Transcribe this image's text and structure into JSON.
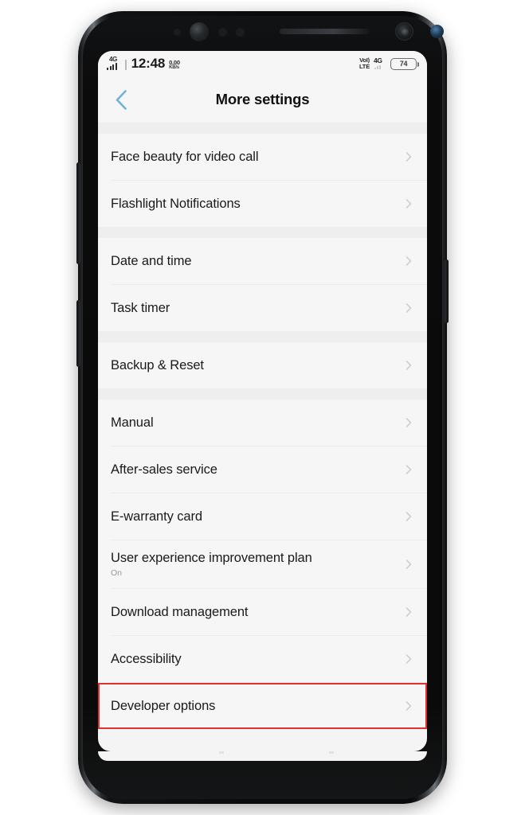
{
  "status_bar": {
    "network_type": "4G",
    "time": "12:48",
    "speed_value": "0.00",
    "speed_unit": "KB/s",
    "volte_line1": "VoI)",
    "volte_line2": "LTE",
    "data_network": "4G",
    "battery_percent": "74"
  },
  "header": {
    "back_label": "Back",
    "title": "More settings"
  },
  "groups": [
    {
      "rows": [
        {
          "title": "Face beauty for video call",
          "sub": ""
        },
        {
          "title": "Flashlight Notifications",
          "sub": ""
        }
      ]
    },
    {
      "rows": [
        {
          "title": "Date and time",
          "sub": ""
        },
        {
          "title": "Task timer",
          "sub": ""
        }
      ]
    },
    {
      "rows": [
        {
          "title": "Backup & Reset",
          "sub": ""
        }
      ]
    },
    {
      "rows": [
        {
          "title": "Manual",
          "sub": ""
        },
        {
          "title": "After-sales service",
          "sub": ""
        },
        {
          "title": "E-warranty card",
          "sub": ""
        },
        {
          "title": "User experience improvement plan",
          "sub": "On"
        },
        {
          "title": "Download management",
          "sub": ""
        },
        {
          "title": "Accessibility",
          "sub": ""
        },
        {
          "title": "Developer options",
          "sub": "",
          "highlighted": true
        }
      ]
    }
  ],
  "colors": {
    "back_chevron": "#6fb4d8",
    "highlight_border": "#e03030",
    "list_bg": "#f6f6f6",
    "group_gap": "#eeeeee",
    "title_text": "#1a1a1a",
    "sub_text": "#9a9a9a",
    "chevron": "#cfcfcf"
  }
}
